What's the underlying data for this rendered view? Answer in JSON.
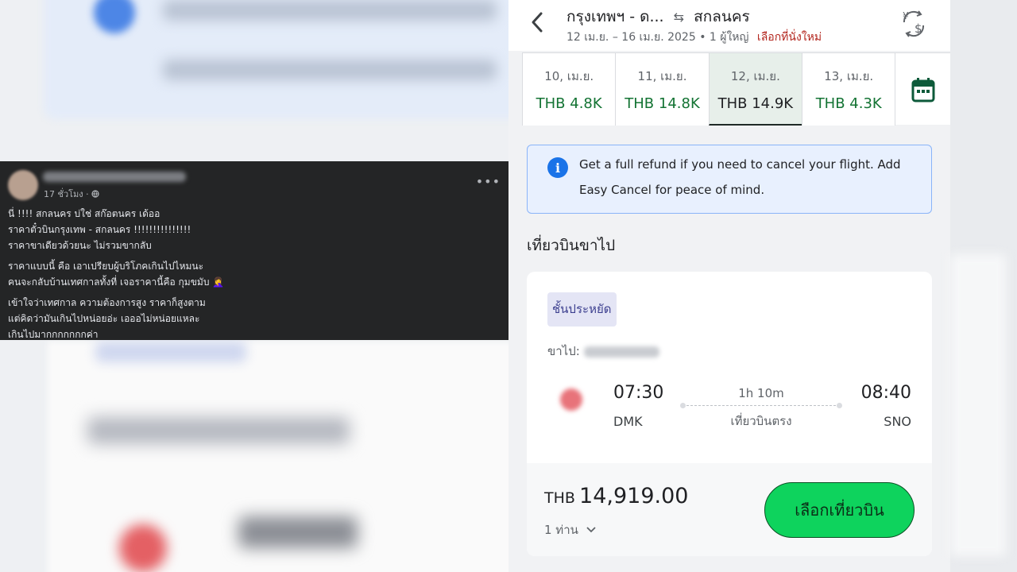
{
  "facebook_post": {
    "timestamp": "17 ชั่วโมง ·",
    "more_icon": "more-icon",
    "paragraphs": [
      [
        "นี่ !!!! สกลนคร บ่ใช่ สก๊อตนคร เด้ออ",
        "ราคาตั๋วบินกรุงเทพ - สกลนคร !!!!!!!!!!!!!!!",
        "ราคาขาเดียวด้วยนะ ไม่รวมขากลับ"
      ],
      [
        "ราคาแบบนี้ คือ เอาเปรียบผู้บริโภคเกินไปไหมนะ",
        "คนจะกลับบ้านเทศกาลทั้งที่ เจอราคานี้คือ กุมขมับ 🤦‍♀️"
      ],
      [
        "เข้าใจว่าเทศกาล ความต้องการสูง ราคาก็สูงตาม",
        "แต่คิดว่ามันเกินไปหน่อยอ่ะ เอออไม่หน่อยแหละ",
        "เกินไปมากกกกกกกค่า"
      ]
    ]
  },
  "flight_app": {
    "header": {
      "origin": "กรุงเทพฯ - ด...",
      "destination": "สกลนคร",
      "dates_passengers": "12 เม.ย. – 16 เม.ย. 2025 • 1 ผู้ใหญ่",
      "reselect_seat": "เลือกที่นั่งใหม่"
    },
    "date_options": [
      {
        "date": "10, เม.ย.",
        "price": "THB 4.8K",
        "selected": false
      },
      {
        "date": "11, เม.ย.",
        "price": "THB 14.8K",
        "selected": false
      },
      {
        "date": "12, เม.ย.",
        "price": "THB 14.9K",
        "selected": true
      },
      {
        "date": "13, เม.ย.",
        "price": "THB 4.3K",
        "selected": false
      }
    ],
    "info_banner": "Get a full refund if you need to cancel your flight. Add Easy Cancel for peace of mind.",
    "section_title": "เที่ยวบินขาไป",
    "flight": {
      "cabin_class": "ชั้นประหยัด",
      "outbound_label": "ขาไป:",
      "depart_time": "07:30",
      "depart_airport": "DMK",
      "arrive_time": "08:40",
      "arrive_airport": "SNO",
      "duration": "1h 10m",
      "stops": "เที่ยวบินตรง"
    },
    "price": {
      "currency": "THB",
      "amount": "14,919.00",
      "passengers": "1 ท่าน"
    },
    "select_button": "เลือกเที่ยวบิน",
    "colors": {
      "price_green": "#137333",
      "button_green": "#0ed35d",
      "reselect_red": "#b3261e",
      "info_blue": "#1a73e8"
    }
  }
}
